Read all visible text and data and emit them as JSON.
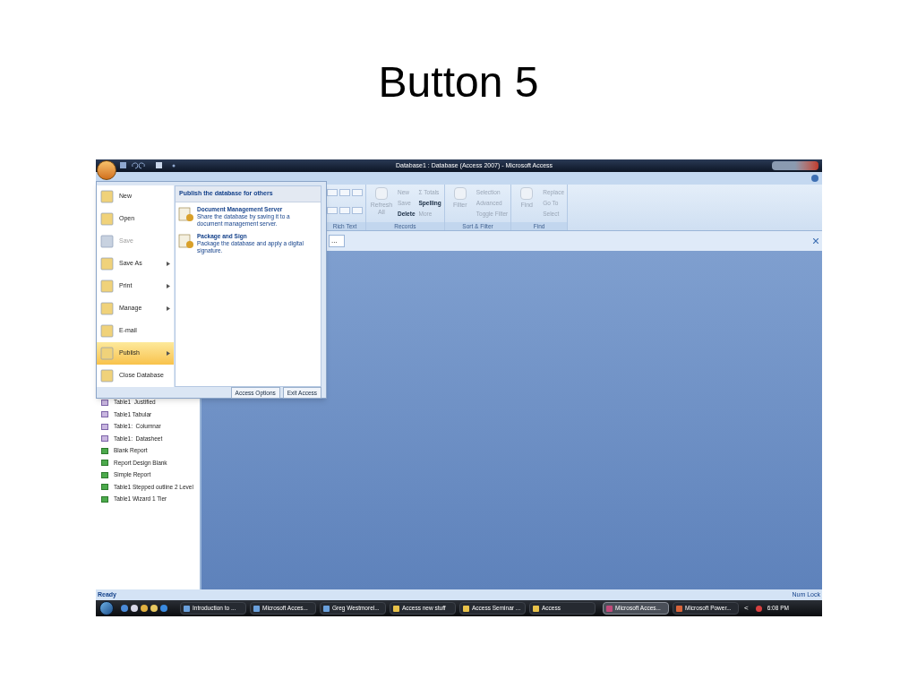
{
  "slide_title": "Button 5",
  "window": {
    "title": "Database1 : Database (Access 2007) - Microsoft Access"
  },
  "ribbon": {
    "groups": [
      {
        "label": "Rich Text"
      },
      {
        "label": "Records",
        "buttons": [
          {
            "label": "Refresh All",
            "kind": "large",
            "disabled": true
          },
          {
            "label": "New",
            "kind": "small",
            "disabled": true
          },
          {
            "label": "Save",
            "kind": "small",
            "disabled": true
          },
          {
            "label": "Delete",
            "kind": "small",
            "disabled": false
          },
          {
            "label": "Σ Totals",
            "kind": "small",
            "disabled": true
          },
          {
            "label": "Spelling",
            "kind": "small",
            "disabled": false
          },
          {
            "label": "More",
            "kind": "small",
            "disabled": true
          }
        ]
      },
      {
        "label": "Sort & Filter",
        "buttons": [
          {
            "label": "Filter",
            "kind": "large",
            "disabled": true
          },
          {
            "label": "Selection",
            "kind": "small",
            "disabled": true
          },
          {
            "label": "Advanced",
            "kind": "small",
            "disabled": true
          },
          {
            "label": "Toggle Filter",
            "kind": "small",
            "disabled": true
          }
        ]
      },
      {
        "label": "Find",
        "buttons": [
          {
            "label": "Find",
            "kind": "large",
            "disabled": true
          },
          {
            "label": "Replace",
            "kind": "small",
            "disabled": true
          },
          {
            "label": "Go To",
            "kind": "small",
            "disabled": true
          },
          {
            "label": "Select",
            "kind": "small",
            "disabled": true
          }
        ]
      }
    ]
  },
  "document_bar": {
    "field_value": "..."
  },
  "office_menu": {
    "items": [
      {
        "label": "New",
        "selected": false,
        "disabled": false,
        "has_submenu": false
      },
      {
        "label": "Open",
        "selected": false,
        "disabled": false,
        "has_submenu": false
      },
      {
        "label": "Save",
        "selected": false,
        "disabled": true,
        "has_submenu": false
      },
      {
        "label": "Save As",
        "selected": false,
        "disabled": false,
        "has_submenu": true
      },
      {
        "label": "Print",
        "selected": false,
        "disabled": false,
        "has_submenu": true
      },
      {
        "label": "Manage",
        "selected": false,
        "disabled": false,
        "has_submenu": true
      },
      {
        "label": "E-mail",
        "selected": false,
        "disabled": false,
        "has_submenu": false
      },
      {
        "label": "Publish",
        "selected": true,
        "disabled": false,
        "has_submenu": true
      },
      {
        "label": "Close Database",
        "selected": false,
        "disabled": false,
        "has_submenu": false
      }
    ],
    "submenu": {
      "heading": "Publish the database for others",
      "entries": [
        {
          "title": "Document Management Server",
          "description": "Share the database by saving it to a document management server."
        },
        {
          "title": "Package and Sign",
          "description": "Package the database and apply a digital signature."
        }
      ]
    },
    "footer_buttons": [
      "Access Options",
      "Exit Access"
    ]
  },
  "navigation_pane": {
    "items": [
      {
        "label": "Table1  Justified",
        "kind": "form"
      },
      {
        "label": "Table1 Tabular",
        "kind": "form"
      },
      {
        "label": "Table1:  Columnar",
        "kind": "form"
      },
      {
        "label": "Table1:  Datasheet",
        "kind": "form"
      },
      {
        "label": "Blank Report",
        "kind": "report"
      },
      {
        "label": "Report Design Blank",
        "kind": "report"
      },
      {
        "label": "Simple Report",
        "kind": "report"
      },
      {
        "label": "Table1 Stepped outline 2 Level",
        "kind": "report"
      },
      {
        "label": "Table1 Wizard 1 Tier",
        "kind": "report"
      }
    ]
  },
  "status_bar": {
    "left": "Ready",
    "right": "Num Lock"
  },
  "taskbar": {
    "buttons": [
      {
        "label": "Introduction to ...",
        "kind": "document",
        "active": false
      },
      {
        "label": "Microsoft Acces...",
        "kind": "document",
        "active": false
      },
      {
        "label": "Greg Westmorel...",
        "kind": "document",
        "active": false
      },
      {
        "label": "Access new stuff",
        "kind": "folder",
        "active": false
      },
      {
        "label": "Access Seminar ...",
        "kind": "folder",
        "active": false
      },
      {
        "label": "Access",
        "kind": "folder",
        "active": false
      },
      {
        "label": "Microsoft Acces...",
        "kind": "access",
        "active": true
      },
      {
        "label": "Microsoft Power...",
        "kind": "powerpoint",
        "active": false
      }
    ],
    "tray_arrow": "<",
    "clock": "6:08 PM"
  }
}
